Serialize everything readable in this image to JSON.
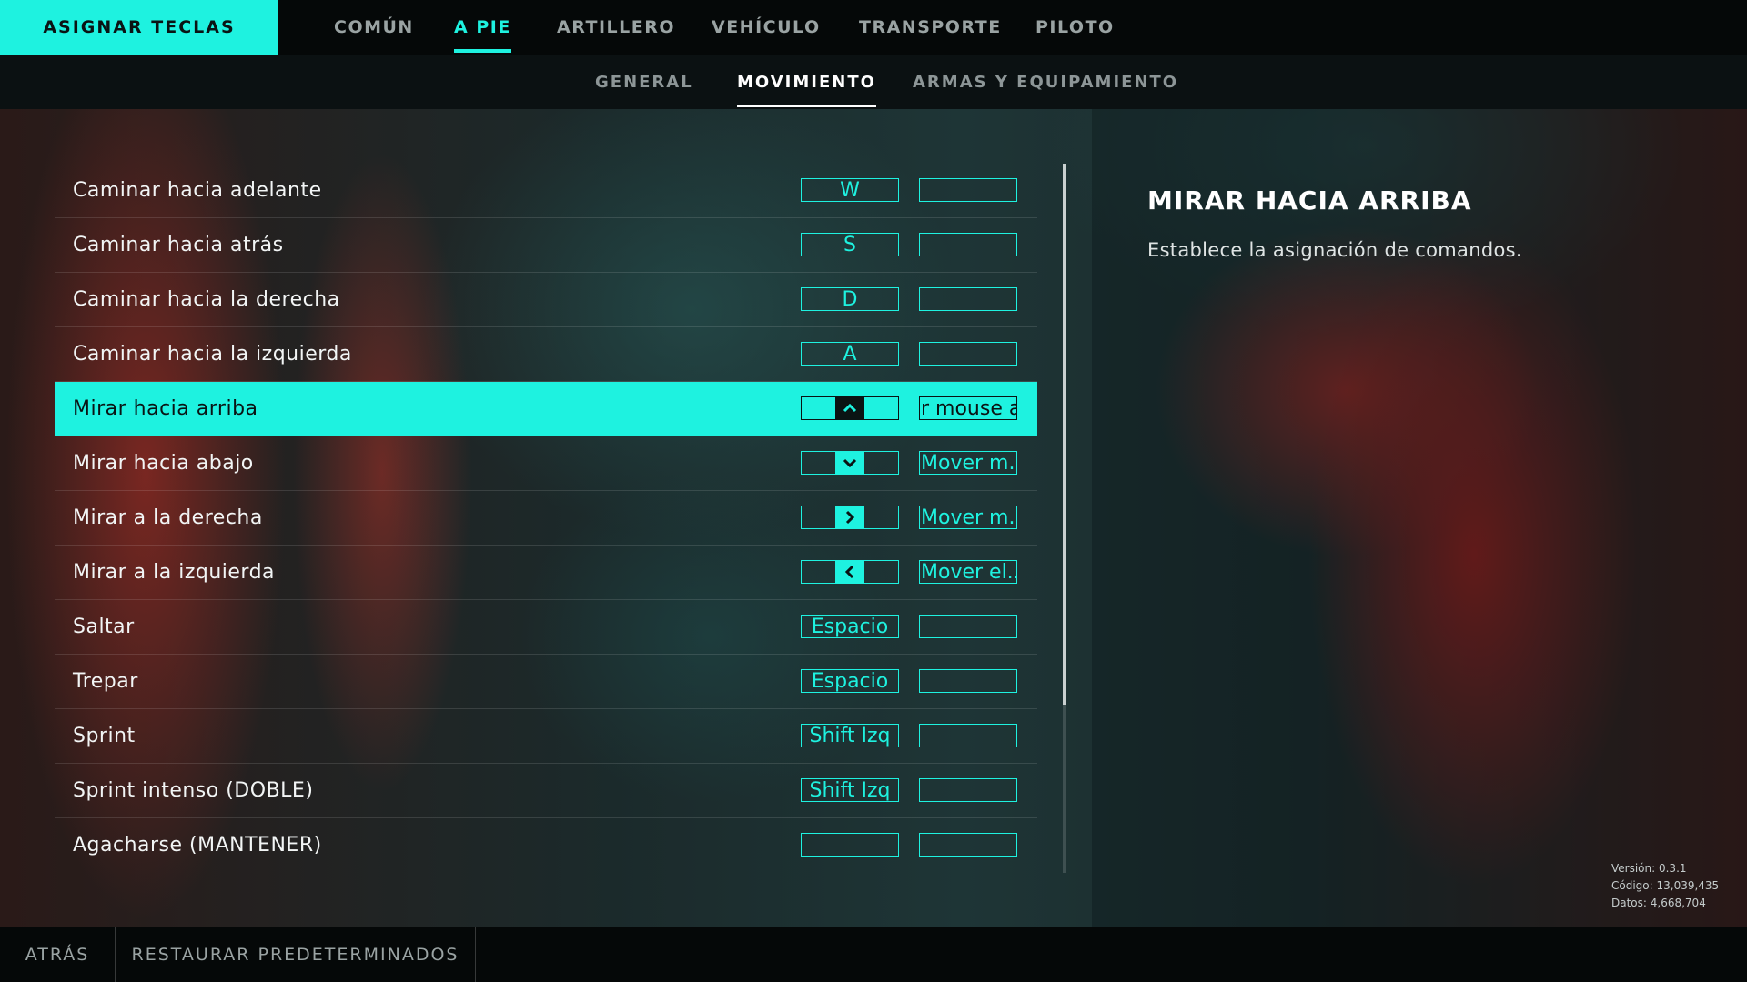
{
  "header": {
    "title": "ASIGNAR TECLAS",
    "tabs": [
      {
        "label": "COMÚN",
        "active": false
      },
      {
        "label": "A PIE",
        "active": true
      },
      {
        "label": "ARTILLERO",
        "active": false
      },
      {
        "label": "VEHÍCULO",
        "active": false
      },
      {
        "label": "TRANSPORTE",
        "active": false
      },
      {
        "label": "PILOTO",
        "active": false
      }
    ]
  },
  "subtabs": [
    {
      "label": "GENERAL",
      "active": false
    },
    {
      "label": "MOVIMIENTO",
      "active": true
    },
    {
      "label": "ARMAS Y EQUIPAMIENTO",
      "active": false
    }
  ],
  "bindings": [
    {
      "action": "Caminar hacia adelante",
      "primary": "W",
      "secondary": ""
    },
    {
      "action": "Caminar hacia atrás",
      "primary": "S",
      "secondary": ""
    },
    {
      "action": "Caminar hacia la derecha",
      "primary": "D",
      "secondary": ""
    },
    {
      "action": "Caminar hacia la izquierda",
      "primary": "A",
      "secondary": ""
    },
    {
      "action": "Mirar hacia arriba",
      "primary_icon": "arrow-up-icon",
      "secondary": "r mouse a",
      "selected": true
    },
    {
      "action": "Mirar hacia abajo",
      "primary_icon": "arrow-down-icon",
      "secondary": "Mover m..."
    },
    {
      "action": "Mirar a la derecha",
      "primary_icon": "arrow-right-icon",
      "secondary": "Mover m..."
    },
    {
      "action": "Mirar a la izquierda",
      "primary_icon": "arrow-left-icon",
      "secondary": "Mover el..."
    },
    {
      "action": "Saltar",
      "primary": "Espacio",
      "secondary": ""
    },
    {
      "action": "Trepar",
      "primary": "Espacio",
      "secondary": ""
    },
    {
      "action": "Sprint",
      "primary": "Shift Izq",
      "secondary": ""
    },
    {
      "action": "Sprint intenso (DOBLE)",
      "primary": "Shift Izq",
      "secondary": ""
    },
    {
      "action": "Agacharse (MANTENER)",
      "primary": "",
      "secondary": ""
    }
  ],
  "detail": {
    "title": "MIRAR HACIA ARRIBA",
    "description": "Establece la asignación de comandos."
  },
  "version_info": {
    "version": "Versión: 0.3.1",
    "code": "Código: 13,039,435",
    "data": "Datos: 4,668,704"
  },
  "footer": {
    "back": "ATRÁS",
    "restore": "RESTAURAR PREDETERMINADOS"
  },
  "colors": {
    "accent": "#1ef2e0",
    "bar": "#050808"
  }
}
